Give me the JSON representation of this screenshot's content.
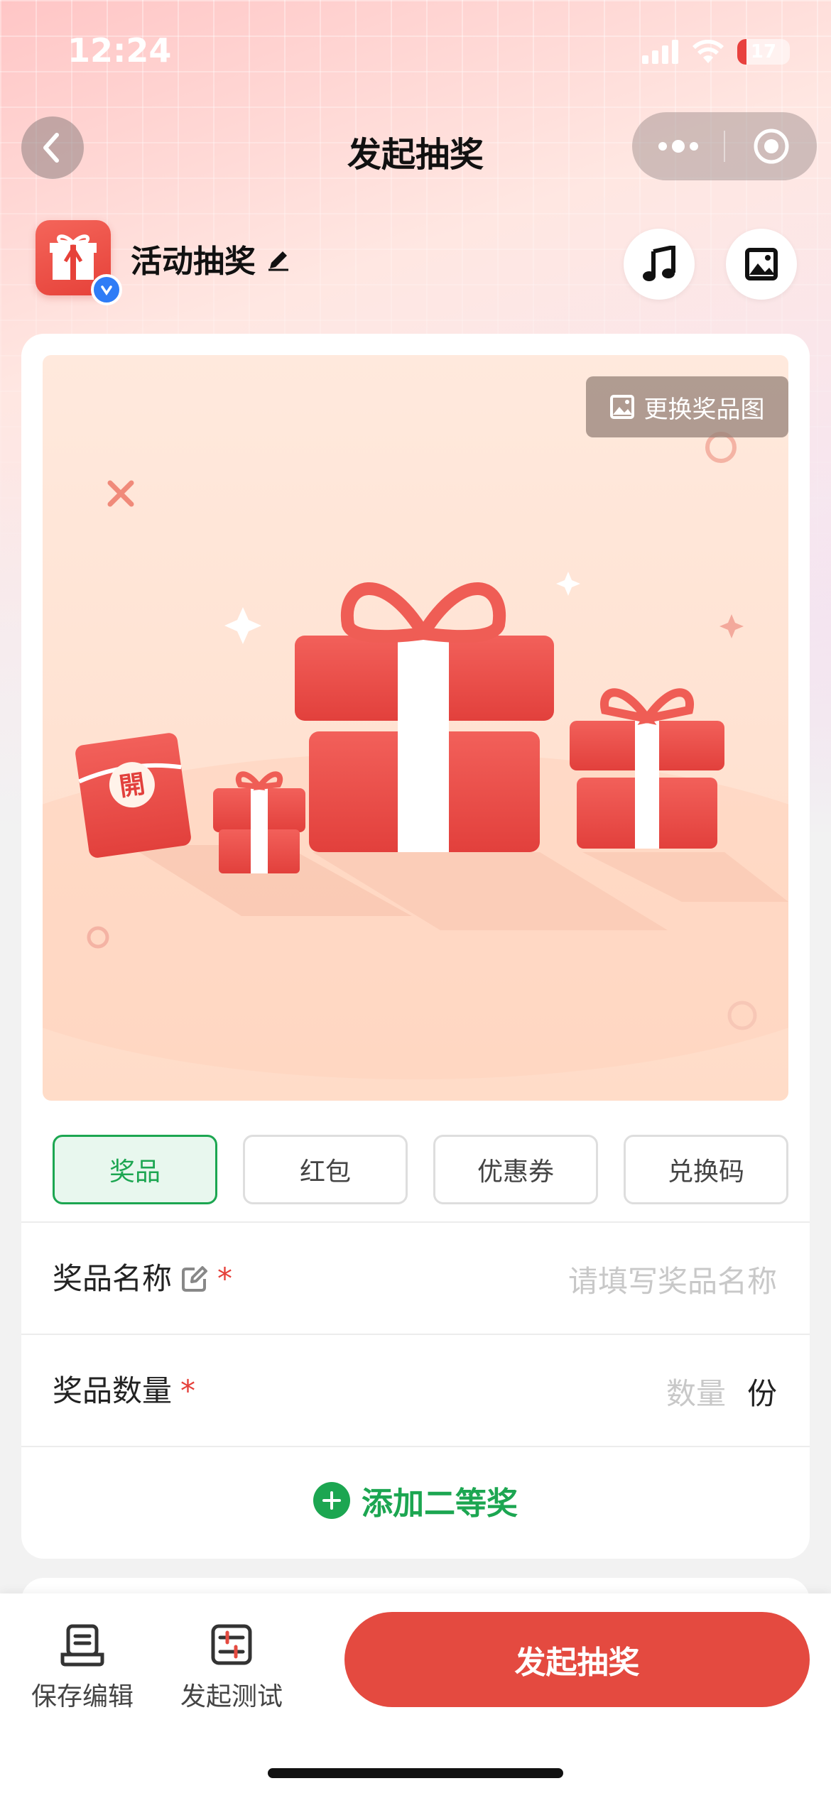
{
  "status_bar": {
    "time": "12:24",
    "battery": "17",
    "battery_level": 0.17
  },
  "nav": {
    "title": "发起抽奖",
    "back_icon": "chevron-left-icon",
    "more_icon": "more-dots-icon",
    "close_icon": "target-icon"
  },
  "header": {
    "activity_name": "活动抽奖",
    "edit_icon": "pencil-icon",
    "music_icon": "music-note-icon",
    "image_icon": "image-icon",
    "verified_icon": "verified-check-icon"
  },
  "prize_image": {
    "change_button": "更换奖品图",
    "badge_text": "開"
  },
  "prize_types": {
    "items": [
      "奖品",
      "红包",
      "优惠券",
      "兑换码"
    ],
    "selected": "奖品"
  },
  "form": {
    "name_label": "奖品名称",
    "name_required": "*",
    "name_placeholder": "请填写奖品名称",
    "quantity_label": "奖品数量",
    "quantity_required": "*",
    "quantity_placeholder": "数量",
    "quantity_unit": "份"
  },
  "add_prize": {
    "icon": "plus-circle-icon",
    "label": "添加二等奖"
  },
  "bottom_bar": {
    "save_label": "保存编辑",
    "test_label": "发起测试",
    "launch_label": "发起抽奖"
  },
  "colors": {
    "accent_green": "#1ca651",
    "launch_red": "#e44a40",
    "required_red": "#e5403a"
  }
}
